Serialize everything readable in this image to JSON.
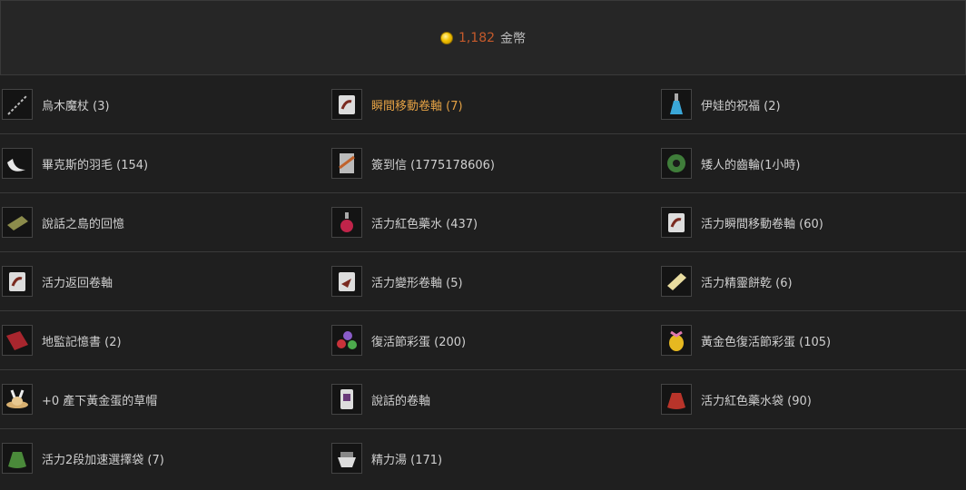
{
  "header": {
    "gold_amount": "1,182",
    "gold_unit": "金幣",
    "coin_icon": "gold-coin-icon",
    "amount_color": "#c55a2b"
  },
  "items": [
    {
      "label": "烏木魔杖 (3)",
      "icon": "wand-icon"
    },
    {
      "label": "瞬間移動卷軸 (7)",
      "icon": "scroll-icon",
      "highlight": true
    },
    {
      "label": "伊娃的祝福 (2)",
      "icon": "potion-bottle-icon"
    },
    {
      "label": "畢克斯的羽毛 (154)",
      "icon": "feather-icon"
    },
    {
      "label": "簽到信 (1775178606)",
      "icon": "letter-icon"
    },
    {
      "label": "矮人的齒輪(1小時)",
      "icon": "gear-icon"
    },
    {
      "label": "說話之島的回憶",
      "icon": "book-icon"
    },
    {
      "label": "活力紅色藥水 (437)",
      "icon": "red-potion-icon"
    },
    {
      "label": "活力瞬間移動卷軸 (60)",
      "icon": "scroll-icon"
    },
    {
      "label": "活力返回卷軸",
      "icon": "scroll-icon"
    },
    {
      "label": "活力變形卷軸 (5)",
      "icon": "scroll-icon"
    },
    {
      "label": "活力精靈餅乾 (6)",
      "icon": "cookie-icon"
    },
    {
      "label": "地監記憶書 (2)",
      "icon": "red-book-icon"
    },
    {
      "label": "復活節彩蛋 (200)",
      "icon": "easter-eggs-icon"
    },
    {
      "label": "黃金色復活節彩蛋 (105)",
      "icon": "golden-egg-icon"
    },
    {
      "label": "+0 產下黃金蛋的草帽",
      "icon": "straw-hat-icon"
    },
    {
      "label": "說話的卷軸",
      "icon": "scroll-icon"
    },
    {
      "label": "活力紅色藥水袋 (90)",
      "icon": "red-bag-icon"
    },
    {
      "label": "活力2段加速選擇袋 (7)",
      "icon": "green-bag-icon"
    },
    {
      "label": "精力湯 (171)",
      "icon": "soup-icon"
    }
  ]
}
